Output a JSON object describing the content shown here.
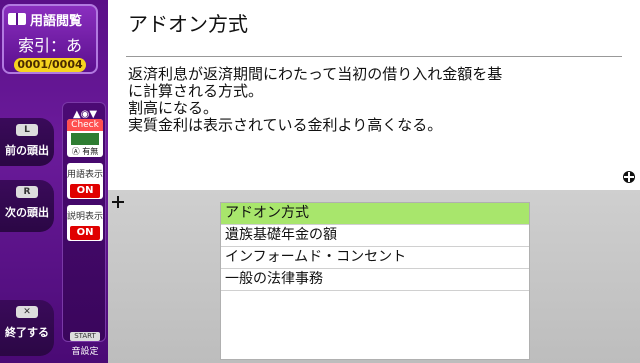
{
  "sidebar": {
    "title": "用語閲覧",
    "index_label": "索引：あ",
    "page_counter": "0001/0004",
    "buttons": [
      {
        "badge": "L",
        "label": "前の頭出"
      },
      {
        "badge": "R",
        "label": "次の頭出"
      },
      {
        "badge": "✕",
        "label": "終了する"
      }
    ],
    "toggles": {
      "check_label": "Check",
      "check_option": "有無",
      "term_display": {
        "title": "用語表示",
        "state": "ON"
      },
      "desc_display": {
        "title": "説明表示",
        "state": "ON"
      }
    },
    "start": {
      "badge": "START",
      "label": "音設定"
    }
  },
  "main": {
    "title": "アドオン方式",
    "definition_lines": [
      "返済利息が返済期間にわたって当初の借り入れ金額を基",
      "に計算される方式。",
      "割高になる。",
      "実質金利は表示されている金利より高くなる。"
    ]
  },
  "list": {
    "items": [
      "アドオン方式",
      "遺族基礎年金の額",
      "インフォームド・コンセント",
      "一般の法律事務"
    ],
    "selected_index": 0
  },
  "colors": {
    "sidebar_purple": "#5a0f88",
    "selection_green": "#a8e66c",
    "on_red": "#e00000",
    "counter_yellow": "#f6d31f"
  }
}
